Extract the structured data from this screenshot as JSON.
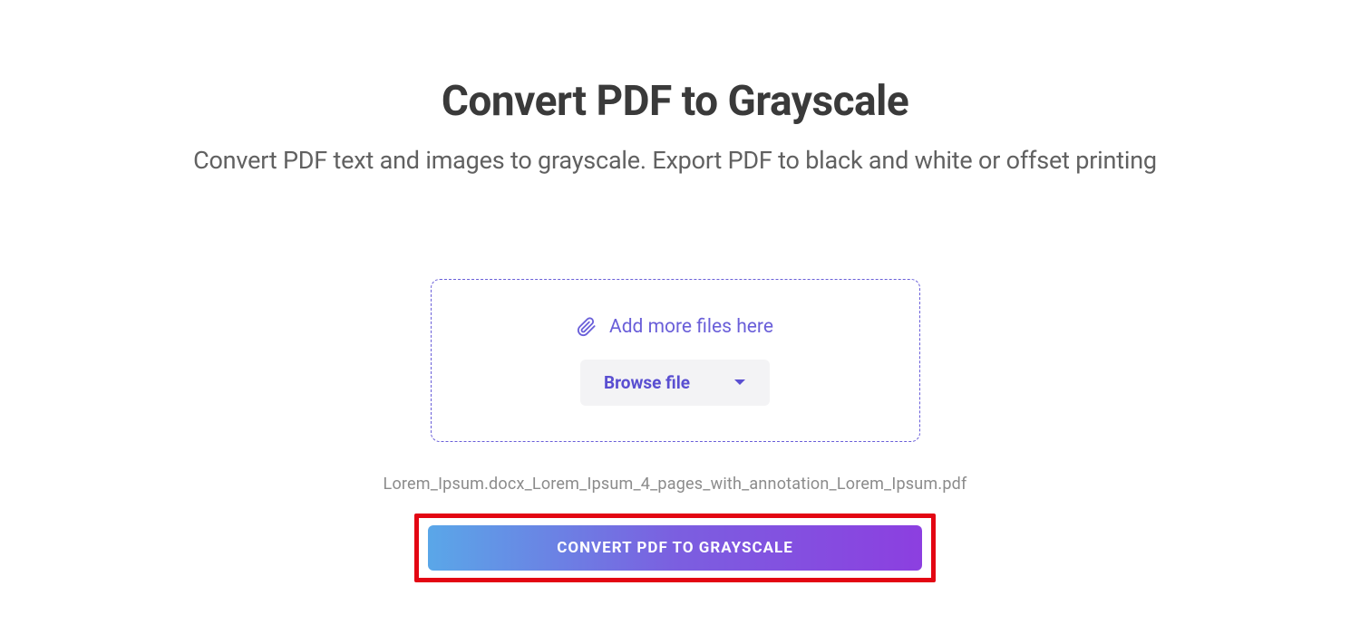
{
  "header": {
    "title": "Convert PDF to Grayscale",
    "subtitle": "Convert PDF text and images to grayscale. Export PDF to black and white or offset printing"
  },
  "dropzone": {
    "add_more_label": "Add more files here",
    "browse_label": "Browse file"
  },
  "file": {
    "name": "Lorem_Ipsum.docx_Lorem_Ipsum_4_pages_with_annotation_Lorem_Ipsum.pdf"
  },
  "actions": {
    "convert_label": "CONVERT PDF TO GRAYSCALE"
  },
  "colors": {
    "accent": "#6a5fd9",
    "highlight": "#e30613"
  }
}
